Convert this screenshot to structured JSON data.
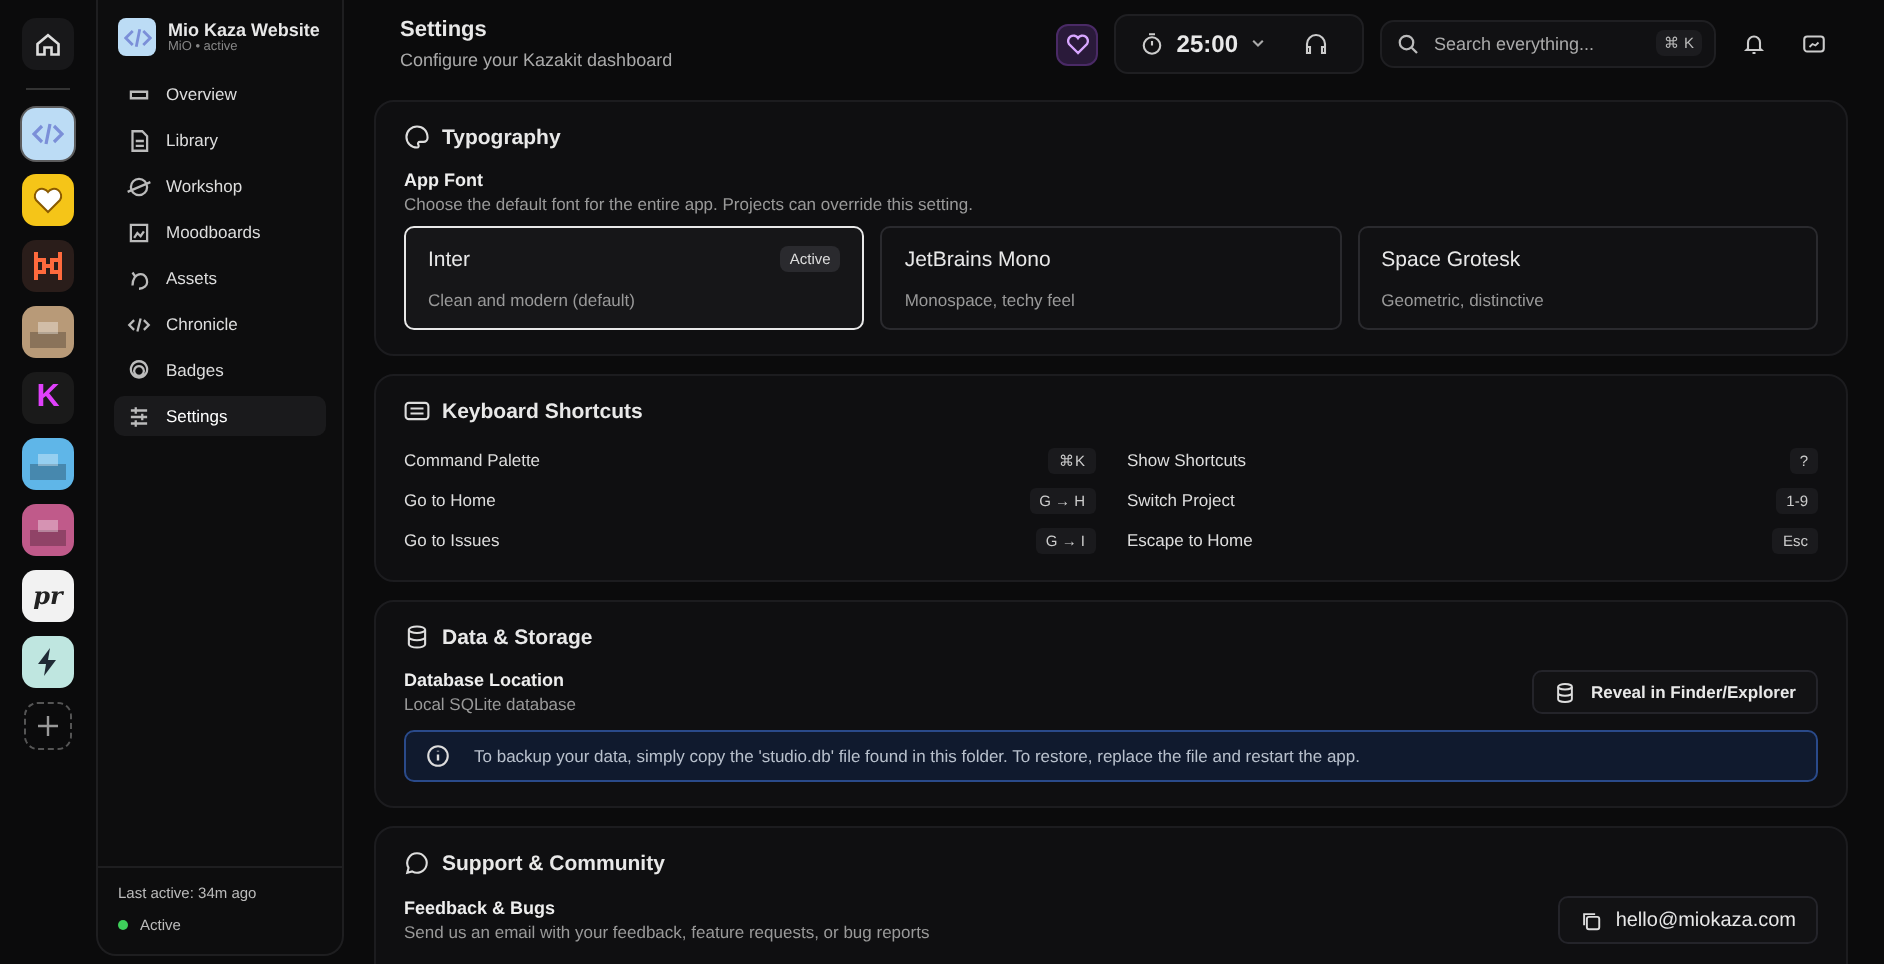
{
  "rail": {
    "apps": [
      {
        "kind": "code",
        "color": "#bcdcf5",
        "selected": true
      },
      {
        "kind": "heart",
        "color": "#f5c518",
        "selected": false
      },
      {
        "kind": "frame",
        "color": "#2a1d1a",
        "selected": false
      },
      {
        "kind": "photo",
        "color": "#b89a78",
        "selected": false
      },
      {
        "kind": "letter",
        "color": "#1a1a1a",
        "label": "K",
        "selected": false
      },
      {
        "kind": "photo",
        "color": "#5fb6e8",
        "selected": false
      },
      {
        "kind": "photo",
        "color": "#c05a8a",
        "selected": false
      },
      {
        "kind": "letter",
        "color": "#f2f2f2",
        "label": "pr",
        "selected": false
      },
      {
        "kind": "bolt",
        "color": "#bfe6e0",
        "selected": false
      }
    ]
  },
  "project": {
    "name": "Mio Kaza Website",
    "subtitle": "MiO • active"
  },
  "sidebar": {
    "items": [
      {
        "label": "Overview",
        "selected": false
      },
      {
        "label": "Library",
        "selected": false
      },
      {
        "label": "Workshop",
        "selected": false
      },
      {
        "label": "Moodboards",
        "selected": false
      },
      {
        "label": "Assets",
        "selected": false
      },
      {
        "label": "Chronicle",
        "selected": false
      },
      {
        "label": "Badges",
        "selected": false
      },
      {
        "label": "Settings",
        "selected": true
      }
    ],
    "last_active": "Last active: 34m ago",
    "status": "Active",
    "online": true
  },
  "header": {
    "title": "Settings",
    "subtitle": "Configure your Kazakit dashboard",
    "timer": "25:00",
    "search": {
      "placeholder": "Search everything...",
      "shortcut": "⌘ K"
    }
  },
  "typography": {
    "title": "Typography",
    "label": "App Font",
    "description": "Choose the default font for the entire app. Projects can override this setting.",
    "fonts": [
      {
        "name": "Inter",
        "description": "Clean and modern (default)",
        "selected": true,
        "badge": "Active"
      },
      {
        "name": "JetBrains Mono",
        "description": "Monospace, techy feel",
        "selected": false
      },
      {
        "name": "Space Grotesk",
        "description": "Geometric, distinctive",
        "selected": false
      }
    ]
  },
  "shortcuts": {
    "title": "Keyboard Shortcuts",
    "items": [
      {
        "label": "Command Palette",
        "keys": "⌘K"
      },
      {
        "label": "Show Shortcuts",
        "keys": "?"
      },
      {
        "label": "Go to Home",
        "keys": "G → H"
      },
      {
        "label": "Switch Project",
        "keys": "1-9"
      },
      {
        "label": "Go to Issues",
        "keys": "G → I"
      },
      {
        "label": "Escape to Home",
        "keys": "Esc"
      }
    ]
  },
  "storage": {
    "title": "Data & Storage",
    "label": "Database Location",
    "description": "Local SQLite database",
    "button": "Reveal in Finder/Explorer",
    "info": "To backup your data, simply copy the 'studio.db' file found in this folder. To restore, replace the file and restart the app."
  },
  "support": {
    "title": "Support & Community",
    "label": "Feedback & Bugs",
    "description": "Send us an email with your feedback, feature requests, or bug reports",
    "button": "hello@miokaza.com"
  }
}
